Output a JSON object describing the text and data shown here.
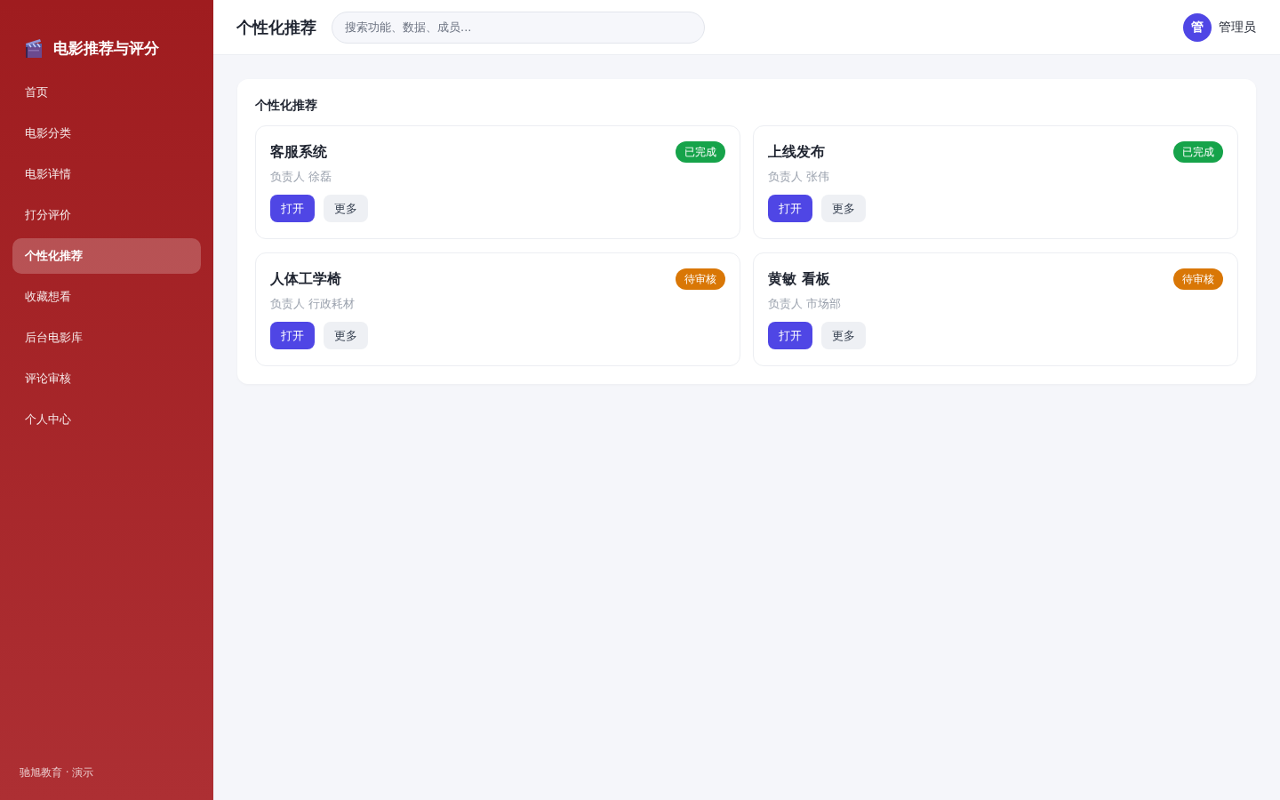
{
  "sidebar": {
    "brand": "电影推荐与评分",
    "items": [
      {
        "label": "首页",
        "selected": false
      },
      {
        "label": "电影分类",
        "selected": false
      },
      {
        "label": "电影详情",
        "selected": false
      },
      {
        "label": "打分评价",
        "selected": false
      },
      {
        "label": "个性化推荐",
        "selected": true
      },
      {
        "label": "收藏想看",
        "selected": false
      },
      {
        "label": "后台电影库",
        "selected": false
      },
      {
        "label": "评论审核",
        "selected": false
      },
      {
        "label": "个人中心",
        "selected": false
      }
    ],
    "footer": "驰旭教育 · 演示"
  },
  "header": {
    "title": "个性化推荐",
    "search": {
      "placeholder": "搜索功能、数据、成员..."
    },
    "user": {
      "avatar": "管",
      "name": "管理员"
    }
  },
  "panel": {
    "title": "个性化推荐",
    "cards": [
      {
        "title": "客服系统",
        "owner": "负责人 徐磊",
        "status": {
          "label": "已完成",
          "color": "#16a34a"
        },
        "buttons": [
          "打开",
          "更多"
        ]
      },
      {
        "title": "上线发布",
        "owner": "负责人 张伟",
        "status": {
          "label": "已完成",
          "color": "#16a34a"
        },
        "buttons": [
          "打开",
          "更多"
        ]
      },
      {
        "title": "人体工学椅",
        "owner": "负责人 行政耗材",
        "status": {
          "label": "待审核",
          "color": "#d97706"
        },
        "buttons": [
          "打开",
          "更多"
        ]
      },
      {
        "title": "黄敏 看板",
        "owner": "负责人 市场部",
        "status": {
          "label": "待审核",
          "color": "#d97706"
        },
        "buttons": [
          "打开",
          "更多"
        ]
      }
    ]
  }
}
